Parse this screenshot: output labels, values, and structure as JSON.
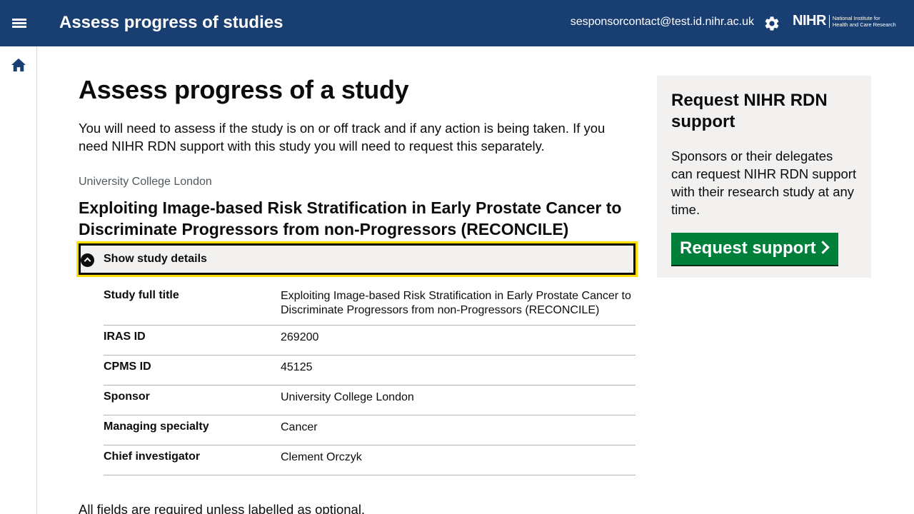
{
  "header": {
    "app_title": "Assess progress of studies",
    "user_email": "sesponsorcontact@test.id.nihr.ac.uk",
    "logo_mark": "NIHR",
    "logo_text_line1": "National Institute for",
    "logo_text_line2": "Health and Care Research",
    "bar_color": "#193e72"
  },
  "main": {
    "page_title": "Assess progress of a study",
    "intro": "You will need to assess if the study is on or off track and if any action is being taken. If you need NIHR RDN support with this study you will need to request this separately.",
    "caption": "University College London",
    "study_title": "Exploiting Image-based Risk Stratification in Early Prostate Cancer to Discriminate Progressors from non-Progressors (RECONCILE)",
    "details_label": "Show study details",
    "study_details": [
      {
        "key": "Study full title",
        "value": "Exploiting Image-based Risk Stratification in Early Prostate Cancer to Discriminate Progressors from non-Progressors (RECONCILE)"
      },
      {
        "key": "IRAS ID",
        "value": "269200"
      },
      {
        "key": "CPMS ID",
        "value": "45125"
      },
      {
        "key": "Sponsor",
        "value": "University College London"
      },
      {
        "key": "Managing specialty",
        "value": "Cancer"
      },
      {
        "key": "Chief investigator",
        "value": "Clement Orczyk"
      }
    ],
    "required_note": "All fields are required unless labelled as optional."
  },
  "sidebar": {
    "title": "Request NIHR RDN support",
    "body": "Sponsors or their delegates can request NIHR RDN support with their research study at any time.",
    "button_label": "Request support",
    "button_color": "#007f3b"
  }
}
